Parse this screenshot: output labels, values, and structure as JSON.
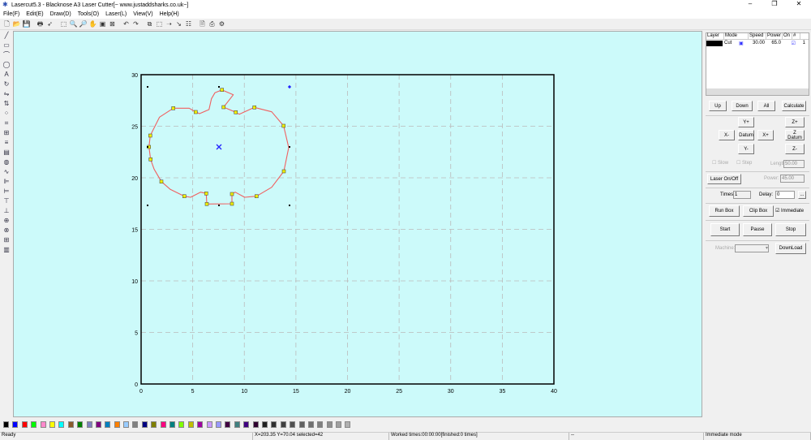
{
  "title": "Lasercut5.3 - Blacknose A3 Laser Cutter[~ www.justaddsharks.co.uk~]",
  "menu": [
    "File(F)",
    "Edit(E)",
    "Draw(D)",
    "Tools(O)",
    "Laser(L)",
    "View(V)",
    "Help(H)"
  ],
  "toolbar_icons": [
    "new-icon",
    "open-icon",
    "save-icon",
    "print-icon",
    "select-icon",
    "node-edit-icon",
    "zoom-in-icon",
    "zoom-out-icon",
    "pan-icon",
    "zoom-page-icon",
    "zoom-fit-icon",
    "undo-icon",
    "redo-icon",
    "group-icon",
    "ungroup-icon",
    "cut-path-icon",
    "laser-line-icon",
    "array-icon",
    "preview-icon",
    "output-icon",
    "machine-icon"
  ],
  "left_tools": [
    "line-icon",
    "rect-icon",
    "polyline-icon",
    "ellipse-icon",
    "text-icon",
    "rotate-icon",
    "mirror-h-icon",
    "mirror-v-icon",
    "nodes-icon",
    "crop-icon",
    "grid-icon",
    "layers-icon",
    "hatch-icon",
    "offset-icon",
    "curve-icon",
    "align-left-icon",
    "align-right-icon",
    "align-top-icon",
    "align-bottom-icon",
    "center-h-icon",
    "center-v-icon",
    "distribute-icon",
    "stack-icon"
  ],
  "canvas": {
    "x_ticks": [
      "0",
      "5",
      "10",
      "15",
      "20",
      "25",
      "30",
      "35",
      "40"
    ],
    "y_ticks": [
      "0",
      "5",
      "10",
      "15",
      "20",
      "25",
      "30"
    ],
    "path_color": "#f06060",
    "background": "#ccfafa"
  },
  "layers": {
    "headers": [
      "Layer",
      "Mode",
      "Speed",
      "Power",
      "On",
      "#"
    ],
    "rows": [
      {
        "color": "#000000",
        "mode": "Cut",
        "speed": "30.00",
        "power": "65.0",
        "on": true,
        "num": "1"
      }
    ]
  },
  "panel": {
    "up": "Up",
    "down": "Down",
    "all": "All",
    "calculate": "Calculate",
    "yplus": "Y+",
    "yminus": "Y-",
    "xminus": "X-",
    "xplus": "X+",
    "datum": "Datum",
    "zplus": "Z+",
    "zdatum": "Z Datum",
    "zminus": "Z-",
    "slow": "Slow",
    "step": "Step",
    "length_label": "Length:",
    "length": "50.00",
    "laser_onoff": "Laser On/Off",
    "power_label": "Power:",
    "power": "45.00",
    "times_label": "Times:",
    "times": "1",
    "delay_label": "Delay:",
    "delay": "0",
    "more": "...",
    "run_box": "Run Box",
    "clip_box": "Clip Box",
    "immediate": "Immediate",
    "start": "Start",
    "pause": "Pause",
    "stop": "Stop",
    "machine_label": "Machine:",
    "download": "DownLoad"
  },
  "palette": [
    "#000000",
    "#0000ff",
    "#ff0000",
    "#00ff00",
    "#ff88cc",
    "#ffff00",
    "#00ffff",
    "#8b5a2b",
    "#008000",
    "#8080c0",
    "#800080",
    "#0080c0",
    "#ff8000",
    "#99ccff",
    "#808080",
    "#000080",
    "#808000",
    "#ff0080",
    "#008080",
    "#80ff00",
    "#c0c000",
    "#a000a0",
    "#cc99ff",
    "#9999ff",
    "#400040",
    "#408080",
    "#400080",
    "#300030",
    "#202020",
    "#303030",
    "#404040",
    "#505050",
    "#606060",
    "#707070",
    "#808080",
    "#909090",
    "#a0a0a0",
    "#b0b0b0"
  ],
  "status": {
    "ready": "Ready",
    "coords": "X=203.35 Y=70.04 selected=42",
    "worked": "Worked times:00:00:00[finished:0 times]",
    "mid": "--",
    "mode": "Immediate mode"
  }
}
